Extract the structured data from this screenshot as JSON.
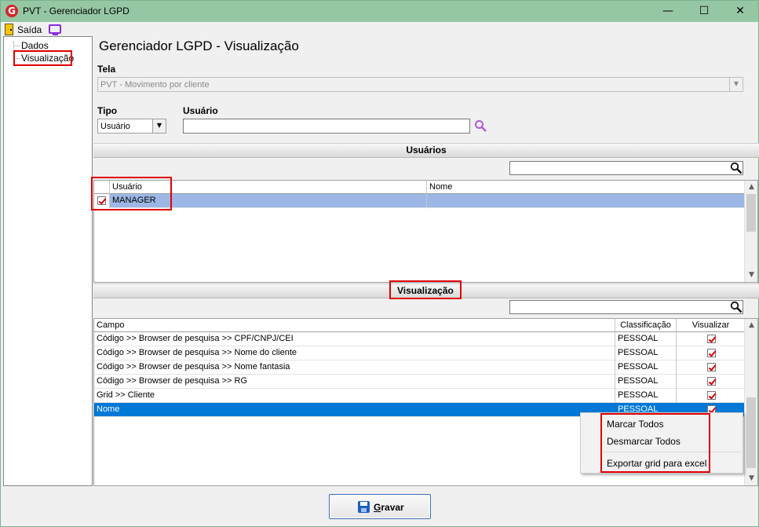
{
  "window": {
    "title": "PVT - Gerenciador LGPD",
    "logo_letter": "G",
    "minimize": "—",
    "maximize": "☐",
    "close": "✕"
  },
  "menu": {
    "saida": "Saída"
  },
  "tree": {
    "items": [
      "Dados",
      "Visualização"
    ],
    "selected": "Visualização"
  },
  "page_title": "Gerenciador LGPD - Visualização",
  "tela": {
    "label": "Tela",
    "value": "PVT - Movimento por cliente"
  },
  "tipo": {
    "label": "Tipo",
    "value": "Usuário"
  },
  "usuario": {
    "label": "Usuário",
    "value": ""
  },
  "usuarios_section": {
    "title": "Usuários",
    "search_value": "",
    "columns": [
      "Usuário",
      "Nome"
    ],
    "rows": [
      {
        "checked": true,
        "usuario": "MANAGER",
        "nome": ""
      }
    ]
  },
  "visualizacao_section": {
    "title": "Visualização",
    "search_value": "",
    "columns": [
      "Campo",
      "Classificação",
      "Visualizar"
    ],
    "rows": [
      {
        "campo": "Código >> Browser de pesquisa >> CPF/CNPJ/CEI",
        "classificacao": "PESSOAL",
        "visualizar": true
      },
      {
        "campo": "Código >> Browser de pesquisa >> Nome do cliente",
        "classificacao": "PESSOAL",
        "visualizar": true
      },
      {
        "campo": "Código >> Browser de pesquisa >> Nome fantasia",
        "classificacao": "PESSOAL",
        "visualizar": true
      },
      {
        "campo": "Código >> Browser de pesquisa >> RG",
        "classificacao": "PESSOAL",
        "visualizar": true
      },
      {
        "campo": "Grid >> Cliente",
        "classificacao": "PESSOAL",
        "visualizar": true
      },
      {
        "campo": "Nome",
        "classificacao": "PESSOAL",
        "visualizar": true
      }
    ],
    "selected_row": 5
  },
  "context_menu": {
    "items": [
      "Marcar Todos",
      "Desmarcar Todos",
      "Exportar grid para excel"
    ]
  },
  "gravar_button": {
    "label_first": "G",
    "label_rest": "ravar"
  },
  "colors": {
    "titlebar": "#96c7a4",
    "selection_blue": "#0078d7",
    "user_row_selected": "#9cb7e6",
    "highlight_red": "#e00000"
  }
}
